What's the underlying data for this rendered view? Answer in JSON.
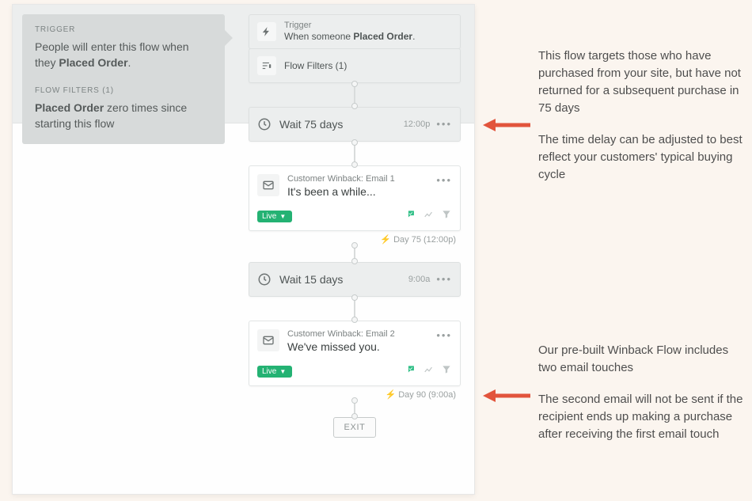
{
  "sidebar": {
    "trigger_heading": "TRIGGER",
    "trigger_line_pre": "People will enter this flow when they ",
    "trigger_line_bold": "Placed Order",
    "trigger_line_post": ".",
    "filters_heading": "FLOW FILTERS (1)",
    "filter_bold": "Placed Order",
    "filter_rest": " zero times since starting this flow"
  },
  "trigger_card": {
    "label": "Trigger",
    "line_pre": "When someone ",
    "line_bold": "Placed Order",
    "line_post": "."
  },
  "filters_card": {
    "label": "Flow Filters (1)"
  },
  "wait1": {
    "label": "Wait 75 days",
    "time": "12:00p"
  },
  "email1": {
    "title": "Customer Winback: Email 1",
    "subject": "It's been a while...",
    "status": "Live",
    "timestamp": "Day 75 (12:00p)"
  },
  "wait2": {
    "label": "Wait 15 days",
    "time": "9:00a"
  },
  "email2": {
    "title": "Customer Winback: Email 2",
    "subject": "We've missed you.",
    "status": "Live",
    "timestamp": "Day 90 (9:00a)"
  },
  "exit": "EXIT",
  "annotations": {
    "a1_p1": "This flow targets those who have purchased from your site, but have not returned for a subsequent purchase in 75 days",
    "a1_p2": "The time delay can be adjusted to best reflect your customers' typical buying cycle",
    "a2_p1": "Our pre-built Winback Flow includes two email touches",
    "a2_p2": "The second email will not be sent if the recipient ends up making a purchase after receiving the first email touch"
  },
  "bolt": "⚡"
}
